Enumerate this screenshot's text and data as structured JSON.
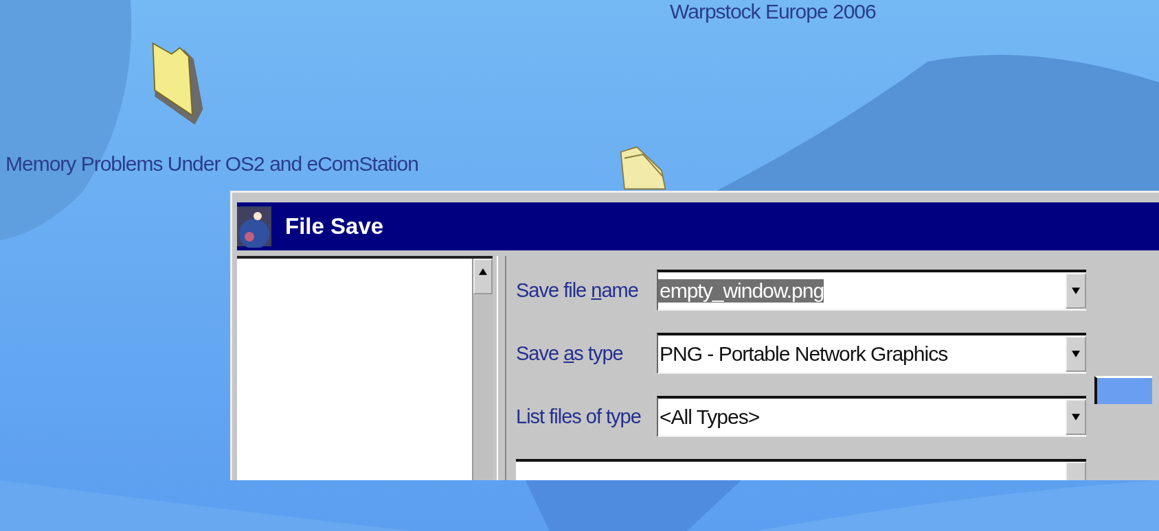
{
  "desktop": {
    "labels": [
      "Warpstock Europe 2006",
      "Memory Problems Under OS2 and eComStation"
    ]
  },
  "dialog": {
    "title": "File Save",
    "fields": [
      {
        "kind": "combo",
        "label_parts": [
          "Save file ",
          "n",
          "ame"
        ],
        "value": "empty_window.png",
        "selected": true
      },
      {
        "kind": "combo",
        "label_parts": [
          "Save ",
          "a",
          "s type"
        ],
        "value": "PNG - Portable Network Graphics",
        "selected": false
      },
      {
        "kind": "combo",
        "label_parts": [
          "List files of type"
        ],
        "value": "<All Types>",
        "selected": false
      }
    ]
  }
}
